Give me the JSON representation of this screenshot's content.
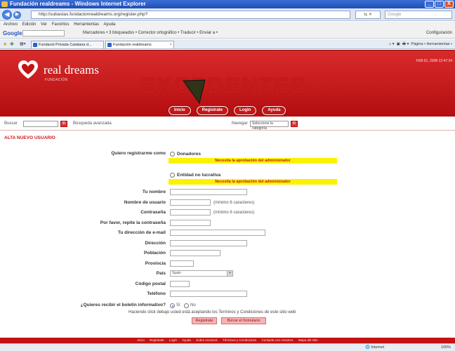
{
  "window": {
    "title": "Fundación realdreams - Windows Internet Explorer",
    "controls": [
      "_",
      "□",
      "X"
    ]
  },
  "browser": {
    "url": "http://subastas.fundacionrealdreams.org/register.php?",
    "search_placeholder": "Google",
    "menu": [
      "Archivo",
      "Edición",
      "Ver",
      "Favoritos",
      "Herramientas",
      "Ayuda"
    ],
    "google_label": "Google",
    "toolbar_items": "Marcadores • 3 bloqueados • Corrector ortográfico • Traducir • Enviar a •",
    "config_label": "Configuración",
    "tabs": [
      {
        "label": "Fundació Privada Catalana d..."
      },
      {
        "label": "Fundación realdreams"
      }
    ],
    "tool_commands": "Página • Herramientas •"
  },
  "site": {
    "logo_name": "real dreams",
    "logo_sub": "FUNDACIÓN",
    "banner_word": "EXCEDENTES",
    "datetime": "FEB 01, 2008 12:47:34",
    "nav": [
      "Inicio",
      "Registrate",
      "Login",
      "Ayuda"
    ],
    "brand_color": "#c41313",
    "notice_color": "#fbf200"
  },
  "searchstrip": {
    "search_label": "Buscar",
    "go_label": "IR",
    "advanced_label": "Búsqueda avanzada",
    "browse_label": "Navegar",
    "category_select": "Seleccione la categoría",
    "browse_go_label": "IR"
  },
  "form": {
    "section_title": "ALTA NUEVO USUARIO",
    "register_as_label": "Quiero registrarme como",
    "options": [
      {
        "label": "Donadores",
        "notice": "Necesita la aprobación del administrador"
      },
      {
        "label": "Entidad no lucrativa",
        "notice": "Necesita la aprobación del administrador"
      }
    ],
    "fields": {
      "name": {
        "label": "Tu nombre"
      },
      "username": {
        "label": "Nombre de usuario",
        "hint": "(mínimo 6 caracteres)"
      },
      "password": {
        "label": "Contraseña",
        "hint": "(mínimo 6 caracteres)"
      },
      "password_repeat": {
        "label": "Por favor, repite la contraseña"
      },
      "email": {
        "label": "Tu dirección de e-mail"
      },
      "address": {
        "label": "Dirección"
      },
      "city": {
        "label": "Población"
      },
      "province": {
        "label": "Provincia"
      },
      "country": {
        "label": "País",
        "value": "Spain"
      },
      "postal": {
        "label": "Código postal"
      },
      "phone": {
        "label": "Teléfono"
      }
    },
    "newsletter": {
      "label": "¿Quieres recibir el boletín informativo?",
      "yes": "Sí",
      "no": "No"
    },
    "terms_text": "Haciendo click debajo usted está aceptando los Terminos y Condiciones de este sitio web",
    "buttons": {
      "submit": "Registrate",
      "reset": "Borrar el formulario"
    }
  },
  "footer": {
    "links": [
      "Inicio",
      "Registrate",
      "Login",
      "Ayuda",
      "Sobre nosotros",
      "Términos y Condiciones",
      "Contacta con nosotros",
      "Mapa del sitio"
    ]
  },
  "status": {
    "zone": "Internet",
    "zoom": "100%"
  }
}
